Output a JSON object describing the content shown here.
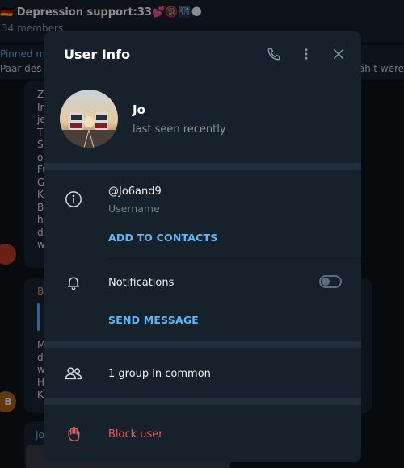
{
  "background_chat": {
    "title": "🇩🇪 Depression support:33💕🔞🌃🌑",
    "members": "34 members",
    "pinned_label": "Pinned m",
    "pinned_text": "Paar des T",
    "pinned_tail": "ählt were",
    "bubble1_lines": "Zi\nIn\nje\nTh\nSo\no\nFu\nG\nK\nB\nh\nd\nw",
    "bubble2_name": "B",
    "bubble2_lines": "M\nd\nw\nH\nK",
    "bubble3_name": "Jo",
    "avatar_b_letter": "B"
  },
  "modal": {
    "title": "User Info",
    "header_icons": [
      "phone-icon",
      "more-vertical-icon",
      "close-icon"
    ],
    "profile": {
      "name": "Jo",
      "status": "last seen recently"
    },
    "info": {
      "username": "@Jo6and9",
      "username_label": "Username",
      "add_contacts": "ADD TO CONTACTS"
    },
    "notifications": {
      "label": "Notifications",
      "enabled": false,
      "send_message": "SEND MESSAGE"
    },
    "groups": {
      "label": "1 group in common"
    },
    "block": {
      "label": "Block user"
    }
  },
  "colors": {
    "accent": "#5eb5f7",
    "danger": "#e55b5b",
    "panel": "#17212b",
    "divider": "#232e3c",
    "muted": "#7f91a4"
  }
}
